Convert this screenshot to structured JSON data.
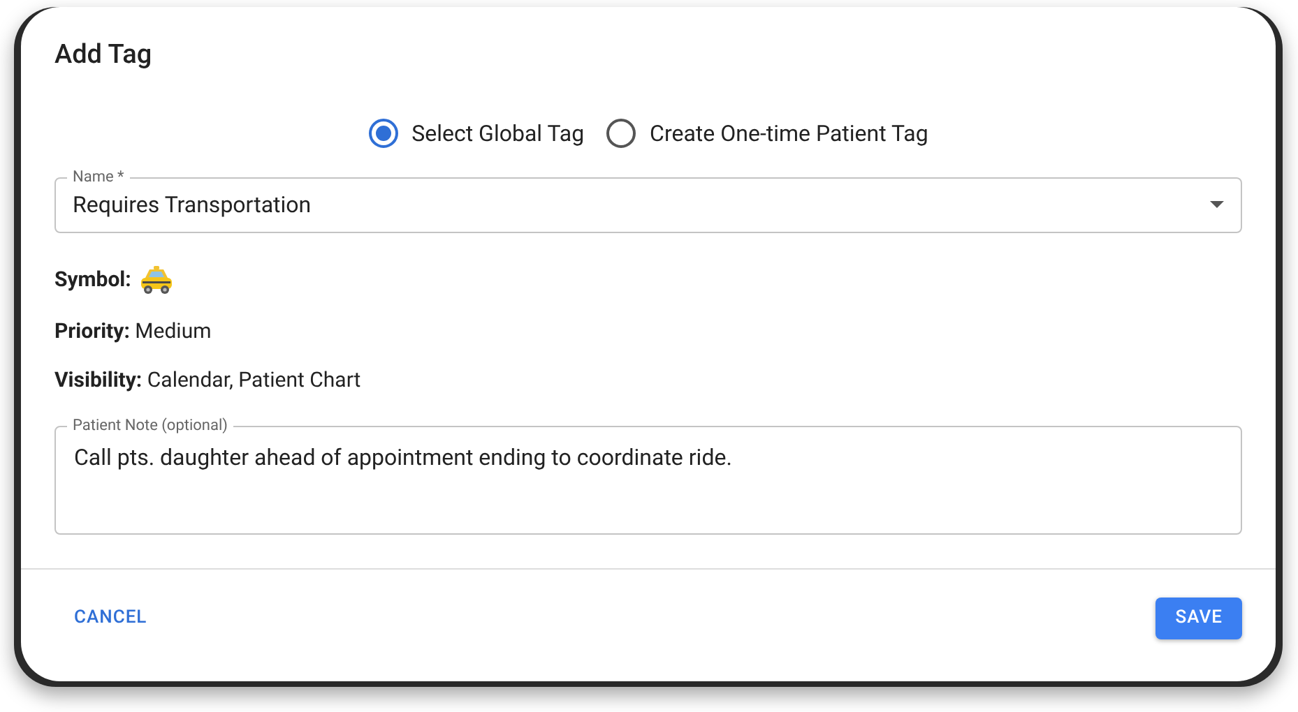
{
  "dialog": {
    "title": "Add Tag"
  },
  "tag_type": [
    {
      "label": "Select Global Tag",
      "selected": true
    },
    {
      "label": "Create One-time Patient Tag",
      "selected": false
    }
  ],
  "name_field": {
    "label": "Name *",
    "value": "Requires Transportation"
  },
  "details": [
    {
      "kind": "icon",
      "label": "Symbol:"
    },
    {
      "kind": "text",
      "label": "Priority:",
      "value": "Medium"
    },
    {
      "kind": "text",
      "label": "Visibility:",
      "value": "Calendar, Patient Chart"
    }
  ],
  "note_field": {
    "label": "Patient Note (optional)",
    "value": "Call pts. daughter ahead of appointment ending to coordinate ride."
  },
  "buttons": [
    {
      "label": "CANCEL",
      "kind": "text"
    },
    {
      "label": "SAVE",
      "kind": "primary"
    }
  ]
}
